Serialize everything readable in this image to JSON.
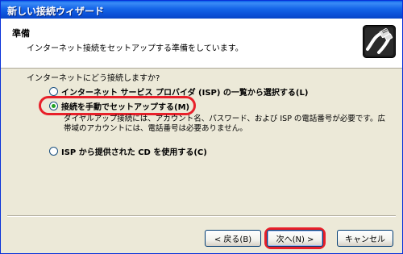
{
  "window": {
    "title": "新しい接続ウィザード"
  },
  "header": {
    "title": "準備",
    "subtitle": "インターネット接続をセットアップする準備をしています。"
  },
  "content": {
    "question": "インターネットにどう接続しますか?",
    "options": [
      {
        "label": "インターネット サービス プロバイダ (ISP) の一覧から選択する(L)",
        "checked": false
      },
      {
        "label": "接続を手動でセットアップする(M)",
        "checked": true
      },
      {
        "label": "ISP から提供された CD を使用する(C)",
        "checked": false
      }
    ],
    "manual_description": "ダイヤルアップ接続には、アカウント名、パスワード、および ISP の電話番号が必要です。広帯域のアカウントには、電話番号は必要ありません。"
  },
  "buttons": {
    "back": "< 戻る(B)",
    "next": "次へ(N) >",
    "cancel": "キャンセル"
  },
  "colors": {
    "titlebar": "#0a5fe8",
    "highlight": "#e8202a",
    "radio_dot": "#21a121"
  },
  "icons": {
    "wizard": "network-cable-icon"
  }
}
